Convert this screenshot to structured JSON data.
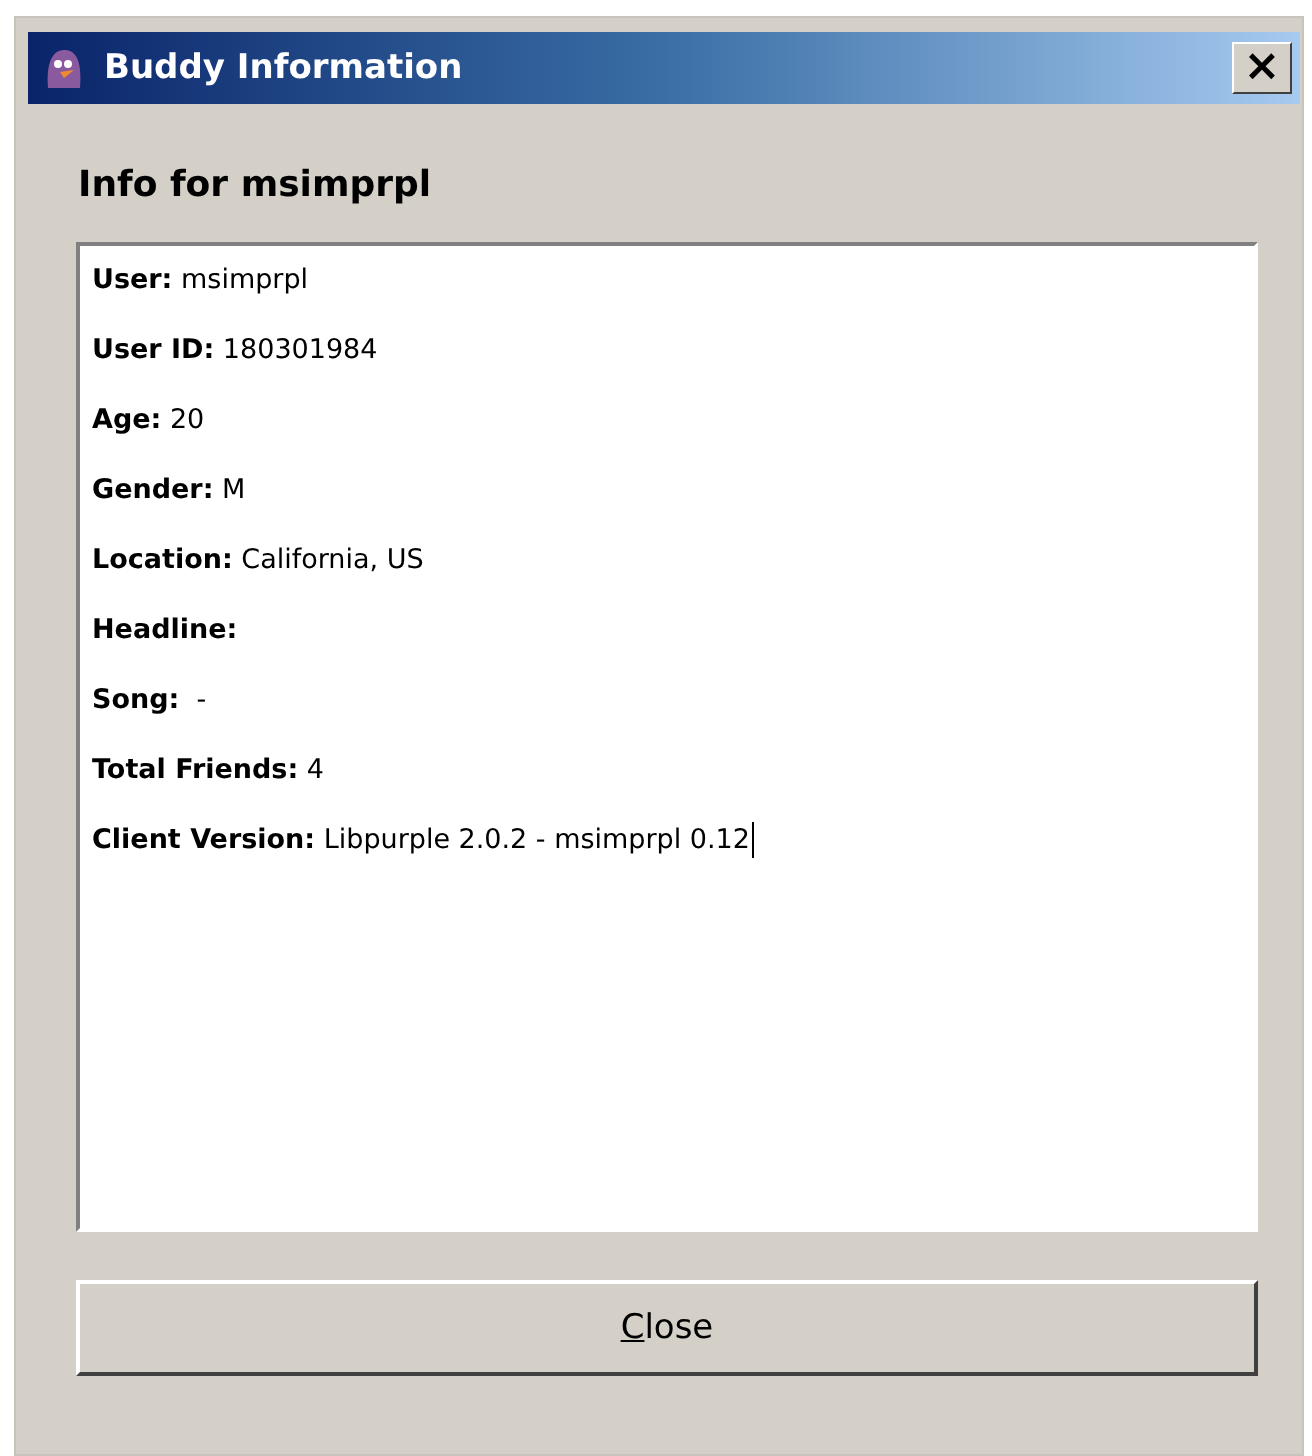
{
  "window": {
    "title": "Buddy Information",
    "close_glyph": "×"
  },
  "heading": "Info for msimprpl",
  "info": [
    {
      "text": "**User:** msimprpl"
    },
    {
      "text": "**User ID:** 180301984"
    },
    {
      "text": "**Age:** 20"
    },
    {
      "text": "**Gender:** M"
    },
    {
      "text": "**Location:** California, US"
    },
    {
      "text": "**Headline:**"
    },
    {
      "text": "**Song:**  -"
    },
    {
      "text": "**Total Friends:** 4"
    },
    {
      "text": "**Client Version:** Libpurple 2.0.2 - msimprpl 0.12",
      "cursor": true
    }
  ],
  "buttons": [
    {
      "label": "Close"
    }
  ]
}
